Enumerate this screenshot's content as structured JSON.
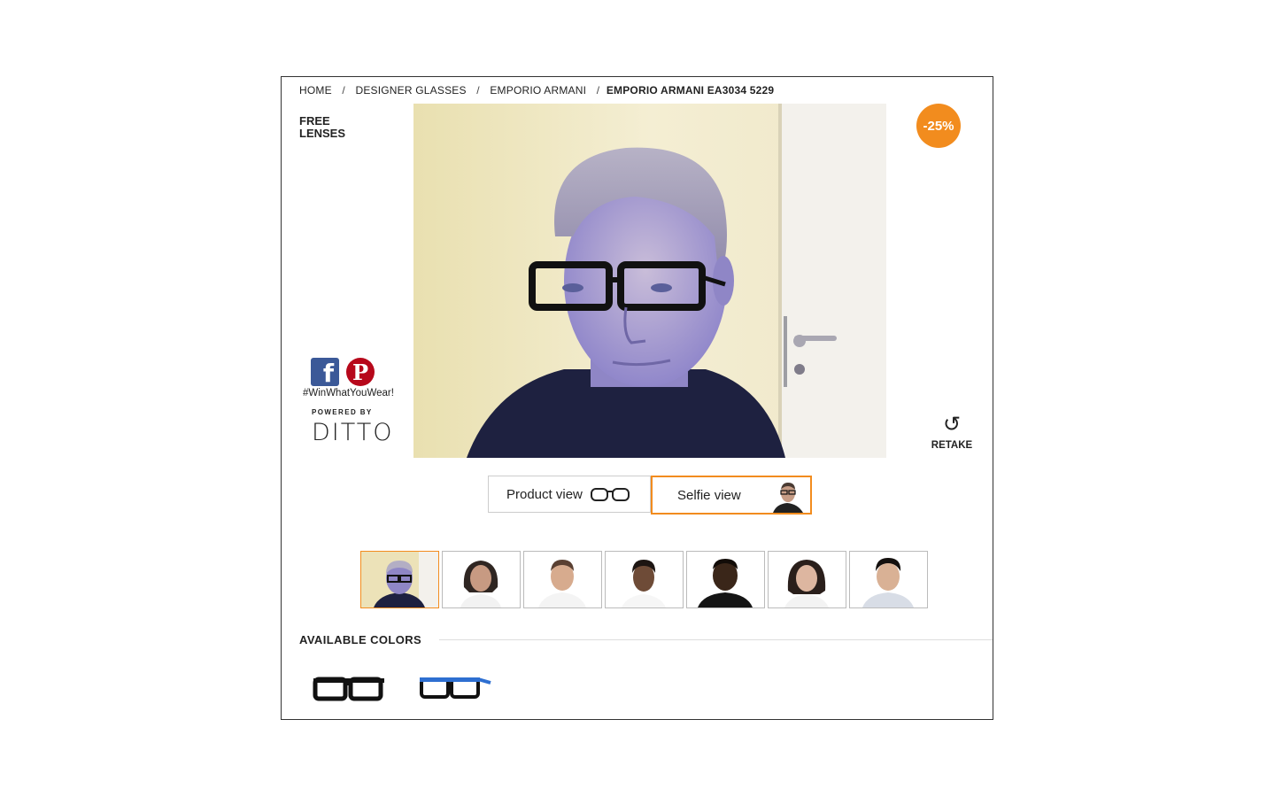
{
  "breadcrumb": {
    "home": "HOME",
    "designer": "DESIGNER GLASSES",
    "brand": "EMPORIO ARMANI",
    "current": "EMPORIO ARMANI EA3034 5229",
    "separator": "/"
  },
  "promo": {
    "free_lenses": "FREE LENSES",
    "discount": "-25%"
  },
  "social": {
    "facebook_glyph": "f",
    "pinterest_glyph": "P",
    "hashtag": "#WinWhatYouWear!",
    "powered_by": "POWERED BY",
    "brand": "DITTO"
  },
  "retake": {
    "label": "RETAKE",
    "icon": "↺"
  },
  "view_toggle": {
    "product_label": "Product view",
    "selfie_label": "Selfie view",
    "active": "selfie"
  },
  "models": {
    "count": 7,
    "active_index": 0
  },
  "colors": {
    "title": "AVAILABLE COLORS",
    "options": [
      "black",
      "blue"
    ]
  },
  "theme": {
    "accent": "#f28c1e",
    "facebook": "#3b5998",
    "pinterest": "#b7081b"
  }
}
